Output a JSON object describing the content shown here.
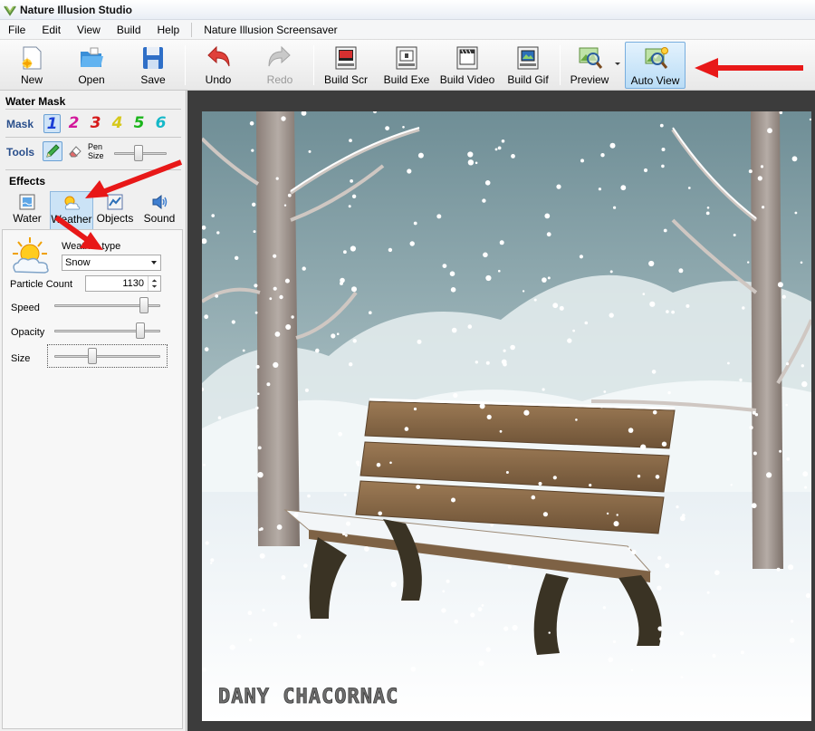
{
  "window": {
    "title": "Nature Illusion Studio"
  },
  "menu": {
    "items": [
      "File",
      "Edit",
      "View",
      "Build",
      "Help"
    ],
    "project": "Nature Illusion Screensaver"
  },
  "toolbar": {
    "new": "New",
    "open": "Open",
    "save": "Save",
    "undo": "Undo",
    "redo": "Redo",
    "build_scr": "Build Scr",
    "build_exe": "Build Exe",
    "build_video": "Build Video",
    "build_gif": "Build Gif",
    "preview": "Preview",
    "auto_view": "Auto View"
  },
  "water_mask": {
    "title": "Water Mask",
    "mask_label": "Mask",
    "masks": [
      "1",
      "2",
      "3",
      "4",
      "5",
      "6"
    ],
    "mask_colors": [
      "#1b3fd6",
      "#d2189b",
      "#d61b1b",
      "#d6c81b",
      "#1bb51b",
      "#14b8c8"
    ],
    "selected_mask": "1",
    "tools_label": "Tools",
    "pen_size_label_1": "Pen",
    "pen_size_label_2": "Size"
  },
  "effects": {
    "title": "Effects",
    "tabs": [
      "Water",
      "Weather",
      "Objects",
      "Sound"
    ],
    "active_tab": "Weather",
    "weather_type_label": "Weather type",
    "weather_type_value": "Snow",
    "particle_count_label": "Particle Count",
    "particle_count_value": "1130",
    "speed_label": "Speed",
    "speed_value_pct": 88,
    "opacity_label": "Opacity",
    "opacity_value_pct": 84,
    "size_label": "Size",
    "size_value_pct": 35
  },
  "canvas": {
    "watermark": "DANY CHACORNAC"
  },
  "colors": {
    "annotation_arrow": "#e81818",
    "active_button": "#b9dcf6"
  }
}
